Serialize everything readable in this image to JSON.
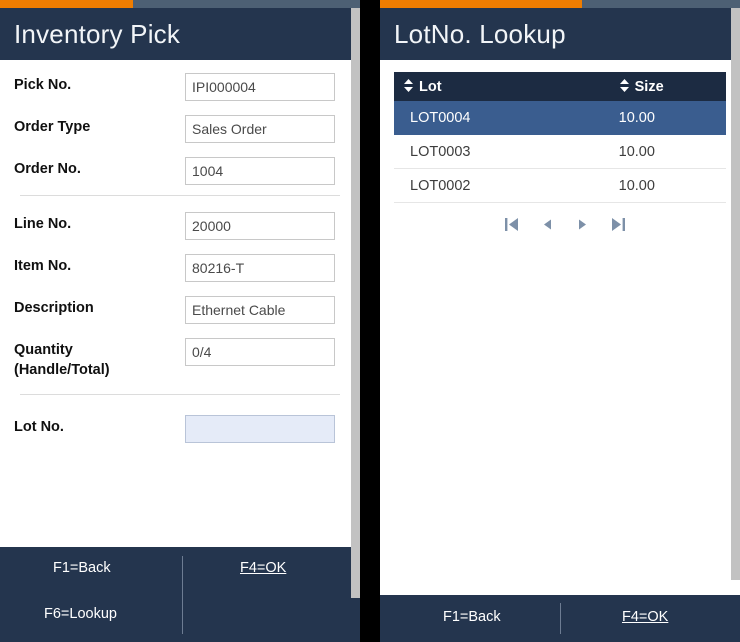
{
  "colors": {
    "accent_orange": "#f07d00",
    "title_bar_navy": "#24354e",
    "grid_header_navy": "#1c2b42",
    "selected_row_blue": "#3a5d8f",
    "progress_track": "#4d6074",
    "focused_field_bg": "#e5ebf8"
  },
  "left_panel": {
    "progress_percent": 37,
    "title": "Inventory Pick",
    "fields": [
      {
        "label": "Pick No.",
        "value": "IPI000004",
        "focused": false
      },
      {
        "label": "Order Type",
        "value": "Sales Order",
        "focused": false
      },
      {
        "label": "Order No.",
        "value": "1004",
        "focused": false
      },
      {
        "label": "Line No.",
        "value": "20000",
        "focused": false
      },
      {
        "label": "Item No.",
        "value": "80216-T",
        "focused": false
      },
      {
        "label": "Description",
        "value": "Ethernet Cable",
        "focused": false
      },
      {
        "label": "Quantity\n(Handle/Total)",
        "value": "0/4",
        "focused": false
      },
      {
        "label": "Lot No.",
        "value": "",
        "focused": true
      }
    ],
    "footer": {
      "back_label": "F1=Back",
      "lookup_label": "F6=Lookup",
      "ok_label": "F4=OK"
    }
  },
  "right_panel": {
    "progress_percent": 56,
    "title": "LotNo. Lookup",
    "grid": {
      "columns": [
        {
          "key": "lot",
          "label": "Lot",
          "sort_icon": "sort-updown-icon"
        },
        {
          "key": "size",
          "label": "Size",
          "sort_icon": "sort-updown-icon"
        }
      ],
      "rows": [
        {
          "lot": "LOT0004",
          "size": "10.00",
          "selected": true
        },
        {
          "lot": "LOT0003",
          "size": "10.00",
          "selected": false
        },
        {
          "lot": "LOT0002",
          "size": "10.00",
          "selected": false
        }
      ]
    },
    "pager": [
      {
        "name": "first-page-icon",
        "glyph": "first"
      },
      {
        "name": "previous-page-icon",
        "glyph": "prev"
      },
      {
        "name": "next-page-icon",
        "glyph": "next"
      },
      {
        "name": "last-page-icon",
        "glyph": "last"
      }
    ],
    "footer": {
      "back_label": "F1=Back",
      "ok_label": "F4=OK"
    }
  }
}
